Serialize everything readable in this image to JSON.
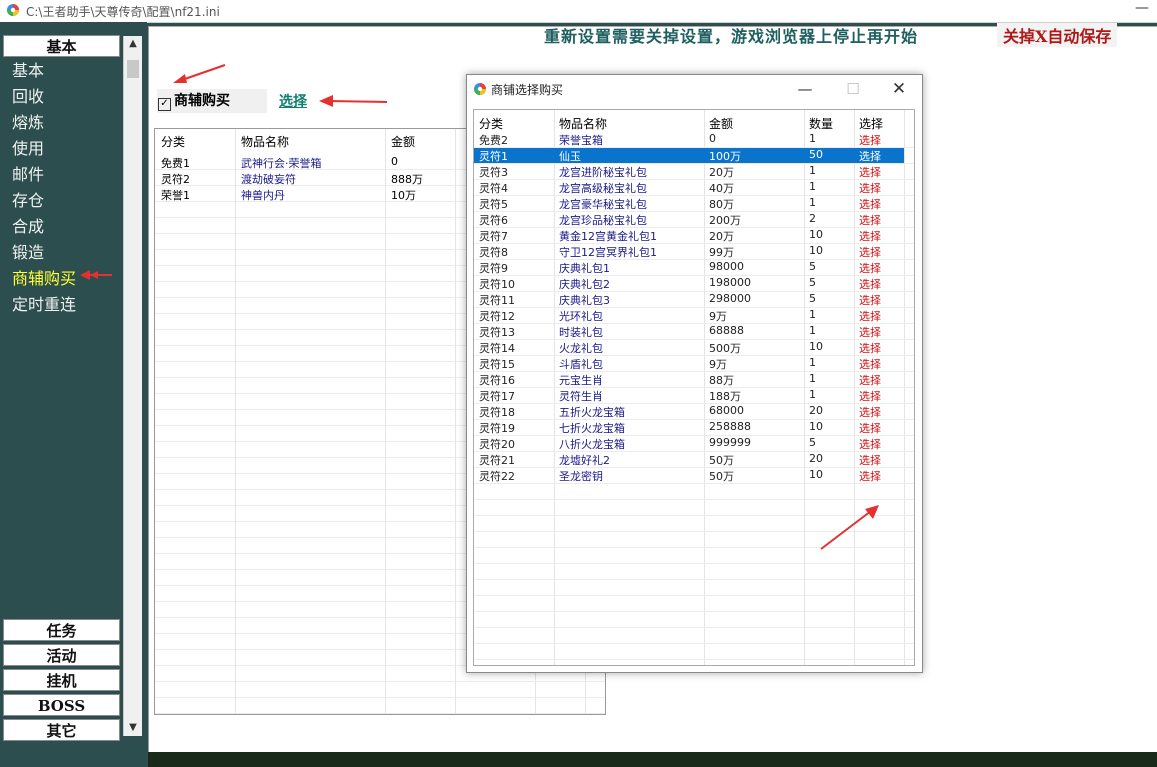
{
  "window": {
    "title": "C:\\王者助手\\天尊传奇\\配置\\nf21.ini",
    "minimize_glyph": "—"
  },
  "sidebar": {
    "top_group": "基本",
    "items": [
      {
        "label": "基本"
      },
      {
        "label": "回收"
      },
      {
        "label": "熔炼"
      },
      {
        "label": "使用"
      },
      {
        "label": "邮件"
      },
      {
        "label": "存仓"
      },
      {
        "label": "合成"
      },
      {
        "label": "锻造"
      },
      {
        "label": "商辅购买",
        "active": true
      },
      {
        "label": "定时重连"
      }
    ],
    "bottom_groups": [
      "任务",
      "活动",
      "挂机",
      "BOSS",
      "其它"
    ]
  },
  "notice": {
    "text": "重新设置需要关掉设置，游戏浏览器上停止再开始",
    "save_text": "关掉X自动保存"
  },
  "shop": {
    "checkbox_label": "商辅购买",
    "checked": true,
    "select_link": "选择"
  },
  "main_table": {
    "headers": [
      "分类",
      "物品名称",
      "金额"
    ],
    "rows": [
      {
        "cat": "免费1",
        "name": "武神行会·荣誉箱",
        "price": "0"
      },
      {
        "cat": "灵符2",
        "name": "渡劫破妄符",
        "price": "888万"
      },
      {
        "cat": "荣誉1",
        "name": "神兽内丹",
        "price": "10万"
      }
    ]
  },
  "dialog": {
    "title": "商铺选择购买",
    "buttons": {
      "min": "—",
      "max": "☐",
      "close": "✕"
    },
    "headers": [
      "分类",
      "物品名称",
      "金额",
      "数量",
      "选择"
    ],
    "selected_index": 1,
    "rows": [
      {
        "cat": "免费2",
        "name": "荣誉宝箱",
        "price": "0",
        "qty": "1",
        "sel": "选择"
      },
      {
        "cat": "灵符1",
        "name": "仙玉",
        "price": "100万",
        "qty": "50",
        "sel": "选择"
      },
      {
        "cat": "灵符3",
        "name": "龙宫进阶秘宝礼包",
        "price": "20万",
        "qty": "1",
        "sel": "选择"
      },
      {
        "cat": "灵符4",
        "name": "龙宫高级秘宝礼包",
        "price": "40万",
        "qty": "1",
        "sel": "选择"
      },
      {
        "cat": "灵符5",
        "name": "龙宫豪华秘宝礼包",
        "price": "80万",
        "qty": "1",
        "sel": "选择"
      },
      {
        "cat": "灵符6",
        "name": "龙宫珍品秘宝礼包",
        "price": "200万",
        "qty": "2",
        "sel": "选择"
      },
      {
        "cat": "灵符7",
        "name": "黄金12宫黄金礼包1",
        "price": "20万",
        "qty": "10",
        "sel": "选择"
      },
      {
        "cat": "灵符8",
        "name": "守卫12宫冥界礼包1",
        "price": "99万",
        "qty": "10",
        "sel": "选择"
      },
      {
        "cat": "灵符9",
        "name": "庆典礼包1",
        "price": "98000",
        "qty": "5",
        "sel": "选择"
      },
      {
        "cat": "灵符10",
        "name": "庆典礼包2",
        "price": "198000",
        "qty": "5",
        "sel": "选择"
      },
      {
        "cat": "灵符11",
        "name": "庆典礼包3",
        "price": "298000",
        "qty": "5",
        "sel": "选择"
      },
      {
        "cat": "灵符12",
        "name": "光环礼包",
        "price": "9万",
        "qty": "1",
        "sel": "选择"
      },
      {
        "cat": "灵符13",
        "name": "时装礼包",
        "price": "68888",
        "qty": "1",
        "sel": "选择"
      },
      {
        "cat": "灵符14",
        "name": "火龙礼包",
        "price": "500万",
        "qty": "10",
        "sel": "选择"
      },
      {
        "cat": "灵符15",
        "name": "斗盾礼包",
        "price": "9万",
        "qty": "1",
        "sel": "选择"
      },
      {
        "cat": "灵符16",
        "name": "元宝生肖",
        "price": "88万",
        "qty": "1",
        "sel": "选择"
      },
      {
        "cat": "灵符17",
        "name": "灵符生肖",
        "price": "188万",
        "qty": "1",
        "sel": "选择"
      },
      {
        "cat": "灵符18",
        "name": "五折火龙宝箱",
        "price": "68000",
        "qty": "20",
        "sel": "选择"
      },
      {
        "cat": "灵符19",
        "name": "七折火龙宝箱",
        "price": "258888",
        "qty": "10",
        "sel": "选择"
      },
      {
        "cat": "灵符20",
        "name": "八折火龙宝箱",
        "price": "999999",
        "qty": "5",
        "sel": "选择"
      },
      {
        "cat": "灵符21",
        "name": "龙墟好礼2",
        "price": "50万",
        "qty": "20",
        "sel": "选择"
      },
      {
        "cat": "灵符22",
        "name": "圣龙密钥",
        "price": "50万",
        "qty": "10",
        "sel": "选择"
      }
    ]
  },
  "colors": {
    "sidebar_bg": "#2c4e4e",
    "active_nav": "#ffff33",
    "select_red": "#d01010",
    "item_name_blue": "#1a1a8a",
    "selected_row": "#0a74cc",
    "arrow_red": "#e63030"
  }
}
